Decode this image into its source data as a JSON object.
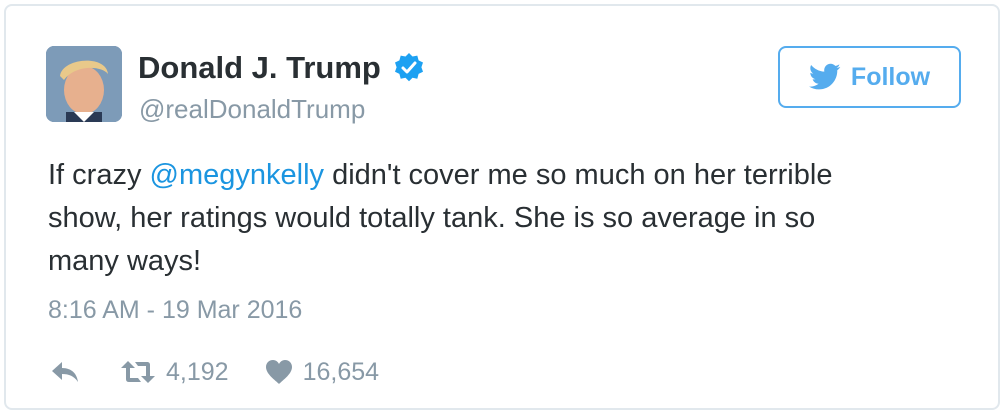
{
  "user": {
    "display_name": "Donald J. Trump",
    "handle": "@realDonaldTrump",
    "verified": true,
    "avatar_icon": "profile-photo"
  },
  "follow_button": {
    "label": "Follow",
    "icon": "twitter-bird-icon"
  },
  "tweet": {
    "line1_before": "If crazy ",
    "mention": "@megynkelly",
    "line1_after": " didn't cover me so much on her terrible",
    "line2": "show, her ratings would totally tank. She is so average in so",
    "line3": "many ways!",
    "timestamp": "8:16 AM - 19 Mar 2016"
  },
  "actions": {
    "reply_icon": "reply-arrow-icon",
    "retweet_icon": "retweet-icon",
    "retweet_count": "4,192",
    "like_icon": "heart-icon",
    "like_count": "16,654"
  },
  "colors": {
    "accent": "#55acee",
    "link": "#1b95e0",
    "text": "#292f33",
    "muted": "#8899a6",
    "border": "#e1e8ed"
  }
}
